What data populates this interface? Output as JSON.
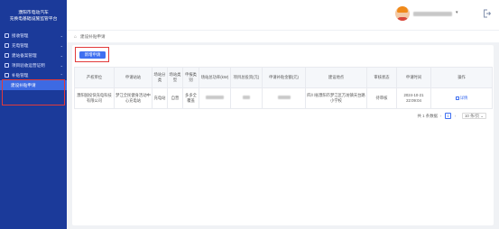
{
  "sidebar": {
    "brand_line1": "濮阳市电动汽车",
    "brand_line2": "充换电基础设施监管平台",
    "items": [
      {
        "label": "接收管理",
        "icon": "monitor-icon"
      },
      {
        "label": "充电管理",
        "icon": "charger-icon"
      },
      {
        "label": "建站备案管理",
        "icon": "document-icon"
      },
      {
        "label": "项目验收运营证明",
        "icon": "certificate-icon"
      },
      {
        "label": "补贴管理",
        "icon": "subsidy-icon"
      }
    ],
    "active_sub": "建设补贴申请"
  },
  "header": {
    "username": "■ ■■■■■■",
    "caret": "▾"
  },
  "breadcrumb": {
    "home_icon": "home-icon",
    "current": "建设补贴申请"
  },
  "toolbar": {
    "apply_label": "新增申请"
  },
  "table": {
    "headers": [
      "产权单位",
      "申请站站",
      "场站分类",
      "场站类型",
      "申报类别",
      "场站总功率(kW)",
      "项目总投资(元)",
      "申请补贴金额(元)",
      "建设地点",
      "审核状态",
      "申请时间",
      "操作"
    ],
    "rows": [
      {
        "owner": "濮阳国投快充电科技有限公司",
        "station": "梦江全民健身活动中心充电站",
        "category": "充电站",
        "type": "自营",
        "declare": "多多全覆盖",
        "power": "",
        "invest": "",
        "amount": "",
        "location": "四川省濮阳市梦江区万坊镇天台路小学校",
        "status": "待审核",
        "time": "2024-10-21 22:09:04",
        "action": "详情"
      }
    ]
  },
  "pagination": {
    "total_text": "共 1 条数据",
    "prev": "‹",
    "current": "1",
    "next": "›",
    "page_size": "10 条/页 ⌄"
  }
}
